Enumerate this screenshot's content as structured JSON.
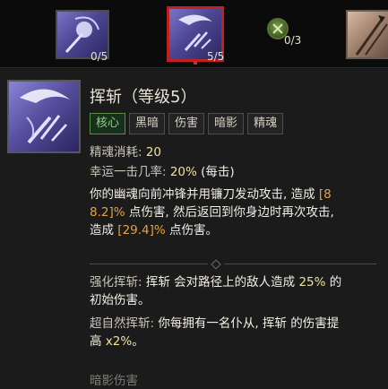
{
  "skill_bar": {
    "slots": [
      {
        "name": "skill-slot-1",
        "rank": "0/5"
      },
      {
        "name": "skill-slot-reap",
        "rank": "5/5"
      },
      {
        "name": "skill-node-enhancement",
        "rank": "0/3"
      }
    ]
  },
  "tooltip": {
    "title": "挥斩（等级5）",
    "tags": [
      "核心",
      "黑暗",
      "伤害",
      "暗影",
      "精魂"
    ],
    "essence_cost_label": "精魂消耗: ",
    "essence_cost_value": "20",
    "lucky_hit_label": "幸运一击几率: ",
    "lucky_hit_value": "20%",
    "lucky_hit_suffix": " (每击)",
    "description": {
      "line1": "你的幽魂向前冲锋并用镰刀发动攻击, 造成 ",
      "damage1_a": "[8",
      "damage1_b": "8.2]%",
      "line2_tail": " 点伤害, 然后返回到你身边时再次攻击,",
      "line3_head": "造成 ",
      "damage2": "[29.4]%",
      "line3_tail": " 点伤害。"
    },
    "enhance": {
      "label": "强化挥斩: ",
      "skill": "挥斩",
      "text1": " 会对路径上的敌人造成 ",
      "value": "25%",
      "text2": " 的",
      "line2": "初始伤害。"
    },
    "supernatural": {
      "label": "超自然挥斩: ",
      "text1": "你每拥有一名仆从, ",
      "skill": "挥斩",
      "text2": " 的伤害提",
      "line2_head": "高 ",
      "value": "x2%",
      "line2_tail": "。"
    },
    "footer": "暗影伤害"
  },
  "colors": {
    "selected_border": "#c21f1f",
    "active_tag": "#8fd18a",
    "value_gold": "#f0e0a0",
    "value_orange": "#e8a040"
  }
}
